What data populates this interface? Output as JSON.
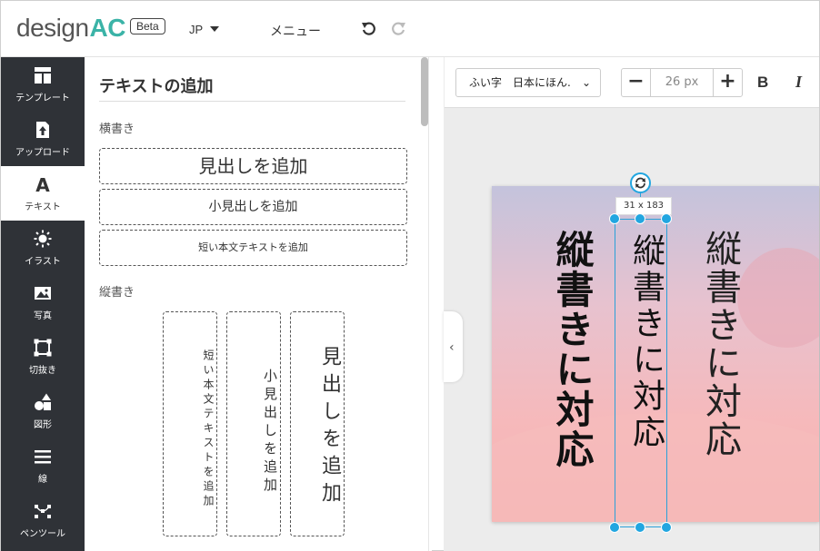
{
  "header": {
    "logo_main": "design",
    "logo_accent": "AC",
    "beta": "Beta",
    "language": "JP",
    "menu": "メニュー"
  },
  "sidebar": {
    "items": [
      {
        "label": "テンプレート",
        "icon": "template-icon"
      },
      {
        "label": "アップロード",
        "icon": "upload-icon"
      },
      {
        "label": "テキスト",
        "icon": "text-icon"
      },
      {
        "label": "イラスト",
        "icon": "illustration-icon"
      },
      {
        "label": "写真",
        "icon": "photo-icon"
      },
      {
        "label": "切抜き",
        "icon": "crop-icon"
      },
      {
        "label": "図形",
        "icon": "shapes-icon"
      },
      {
        "label": "線",
        "icon": "line-icon"
      },
      {
        "label": "ペンツール",
        "icon": "pen-tool-icon"
      }
    ],
    "active_index": 2
  },
  "panel": {
    "title": "テキストの追加",
    "horizontal_label": "横書き",
    "add_heading": "見出しを追加",
    "add_subheading": "小見出しを追加",
    "add_body": "短い本文テキストを追加",
    "vertical_label": "縦書き",
    "v_add_body": "短い本文テキストを追加",
    "v_add_subheading": "小見出しを追加",
    "v_add_heading": "見出しを追加"
  },
  "toolbar": {
    "font": "ふい字　日本にほん.",
    "font_size": "26 px",
    "minus": "−",
    "plus": "+",
    "bold": "B",
    "italic": "I"
  },
  "canvas": {
    "text_bold": "縦書きに対応",
    "text_selected": "縦書きに対応",
    "text_thin": "縦書きに対応",
    "selection_dims": "31 x 183"
  }
}
